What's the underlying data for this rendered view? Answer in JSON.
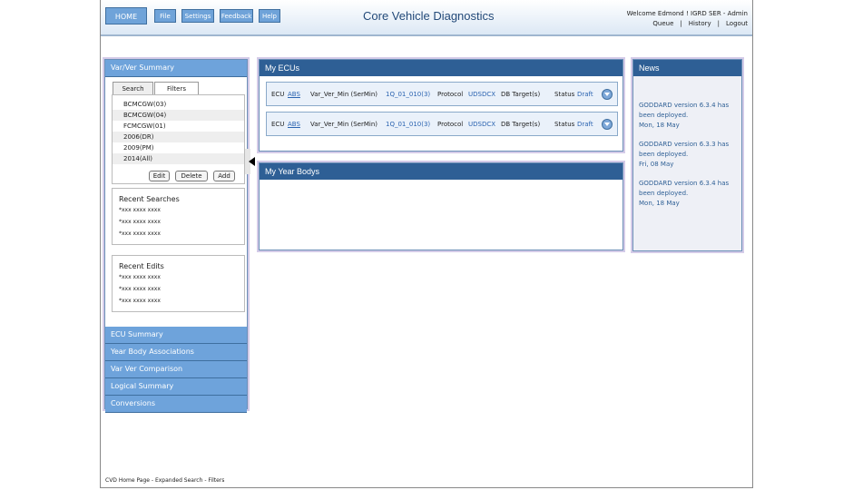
{
  "header": {
    "home_label": "HOME",
    "nav": [
      "File",
      "Settings",
      "Feedback",
      "Help"
    ],
    "title": "Core Vehicle Diagnostics",
    "welcome": "Welcome Edmond !  IGRD SER - Admin",
    "links": [
      "Queue",
      "History",
      "Logout"
    ]
  },
  "sidebar": {
    "expanded_title": "Var/Ver Summary",
    "tabs": [
      "Search",
      "Filters"
    ],
    "filters": [
      "BCMCGW(03)",
      "BCMCGW(04)",
      "FCMCGW(01)",
      "2006(DR)",
      "2009(PM)",
      "2014(All)"
    ],
    "buttons": {
      "edit": "Edit",
      "delete": "Delete",
      "add": "Add"
    },
    "recent_searches": {
      "title": "Recent Searches",
      "items": [
        "*xxx xxxx xxxx",
        "*xxx xxxx xxxx",
        "*xxx xxxx xxxx"
      ]
    },
    "recent_edits": {
      "title": "Recent Edits",
      "items": [
        "*xxx xxxx xxxx",
        "*xxx xxxx xxxx",
        "*xxx xxxx xxxx"
      ]
    },
    "sections": [
      "ECU Summary",
      "Year Body Associations",
      "Var Ver Comparison",
      "Logical Summary",
      "Conversions"
    ]
  },
  "my_ecus": {
    "title": "My ECUs",
    "rows": [
      {
        "ecu_label": "ECU",
        "ecu_value": "ABS",
        "varver_label": "Var_Ver_Min (SerMin)",
        "varver_value": "1Q_01_010(3)",
        "protocol_label": "Protocol",
        "protocol_value": "UDSDCX",
        "db_label": "DB Target(s)",
        "status_label": "Status",
        "status_value": "Draft"
      },
      {
        "ecu_label": "ECU",
        "ecu_value": "ABS",
        "varver_label": "Var_Ver_Min (SerMin)",
        "varver_value": "1Q_01_010(3)",
        "protocol_label": "Protocol",
        "protocol_value": "UDSDCX",
        "db_label": "DB Target(s)",
        "status_label": "Status",
        "status_value": "Draft"
      }
    ]
  },
  "my_year_bodys": {
    "title": "My Year Bodys"
  },
  "news": {
    "title": "News",
    "items": [
      {
        "line1": "GODDARD version 6.3.4 has",
        "line2": "been deployed.",
        "date": "Mon, 18 May"
      },
      {
        "line1": "GODDARD version 6.3.3 has",
        "line2": "been deployed.",
        "date": "Fri, 08 May"
      },
      {
        "line1": "GODDARD version 6.3.4 has",
        "line2": "been deployed.",
        "date": "Mon, 18 May"
      }
    ]
  },
  "footer": "CVD Home Page - Expanded Search - Filters",
  "colors": {
    "panel_header": "#2e5f95",
    "sidebar_header": "#6ea3db",
    "link": "#2a63b0"
  }
}
